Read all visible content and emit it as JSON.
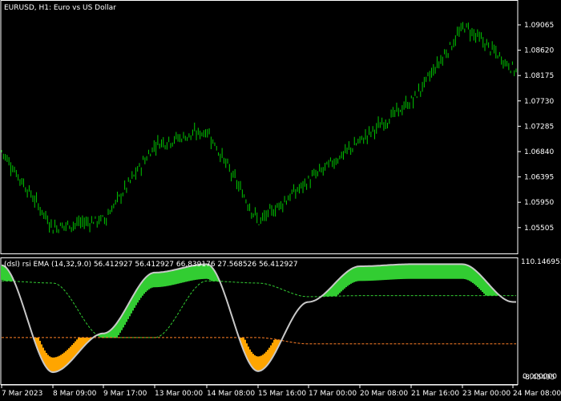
{
  "window": {
    "title": "EURUSD, H1:  Euro vs US Dollar",
    "colors": {
      "background": "#000000",
      "frame": "#ffffff",
      "candle": "#00c800"
    }
  },
  "main_chart": {
    "price_ticks": [
      "1.09065",
      "1.08620",
      "1.08175",
      "1.07730",
      "1.07285",
      "1.06840",
      "1.06395",
      "1.05950",
      "1.05505"
    ]
  },
  "indicator": {
    "header": "(dsl) rsi EMA (14,32,9.0) 56.412927 56.412927 66.839176 27.568526 56.412927",
    "scale_top": "110.146951",
    "scale_bottom": "0.000000",
    "scale_bottom_overlap": "-8.45495",
    "colors": {
      "rsi_line": "#c8c8c8",
      "upper_fill": "#32cd32",
      "lower_fill": "#ffa500",
      "upper_level": "#32cd32",
      "lower_level": "#ff7f27"
    }
  },
  "time_axis": {
    "labels": [
      "7 Mar 2023",
      "8 Mar 09:00",
      "9 Mar 17:00",
      "13 Mar 00:00",
      "14 Mar 08:00",
      "15 Mar 16:00",
      "17 Mar 00:00",
      "20 Mar 08:00",
      "21 Mar 16:00",
      "23 Mar 00:00",
      "24 Mar 08:00"
    ]
  },
  "chart_data": [
    {
      "type": "candlestick",
      "title": "EURUSD, H1:  Euro vs US Dollar",
      "x": [
        "7 Mar 2023",
        "8 Mar 09:00",
        "9 Mar 17:00",
        "13 Mar 00:00",
        "14 Mar 08:00",
        "15 Mar 16:00",
        "17 Mar 00:00",
        "20 Mar 08:00",
        "21 Mar 16:00",
        "23 Mar 00:00",
        "24 Mar 08:00"
      ],
      "close": [
        1.0685,
        1.0551,
        1.0565,
        1.0698,
        1.072,
        1.056,
        1.0635,
        1.0705,
        1.0775,
        1.0905,
        1.0825
      ],
      "ylim": [
        1.053,
        1.0945
      ],
      "grid": false
    },
    {
      "type": "line",
      "title": "(dsl) rsi EMA (14,32,9.0) 56.412927 56.412927 66.839176 27.568526 56.412927",
      "x": [
        "7 Mar 2023",
        "8 Mar 09:00",
        "9 Mar 17:00",
        "13 Mar 00:00",
        "14 Mar 08:00",
        "15 Mar 16:00",
        "17 Mar 00:00",
        "20 Mar 08:00",
        "21 Mar 16:00",
        "23 Mar 00:00",
        "24 Mar 08:00"
      ],
      "ylim": [
        0,
        110.146951
      ],
      "series": [
        {
          "values": [
            105,
            3,
            40,
            98,
            106,
            4,
            70,
            104,
            106,
            106,
            70
          ]
        },
        {
          "values": [
            90,
            88,
            36,
            36,
            90,
            88,
            75,
            76,
            76,
            76,
            76
          ]
        },
        {
          "values": [
            36,
            36,
            36,
            36,
            36,
            36,
            30,
            30,
            30,
            30,
            30
          ]
        }
      ],
      "grid": false
    }
  ]
}
